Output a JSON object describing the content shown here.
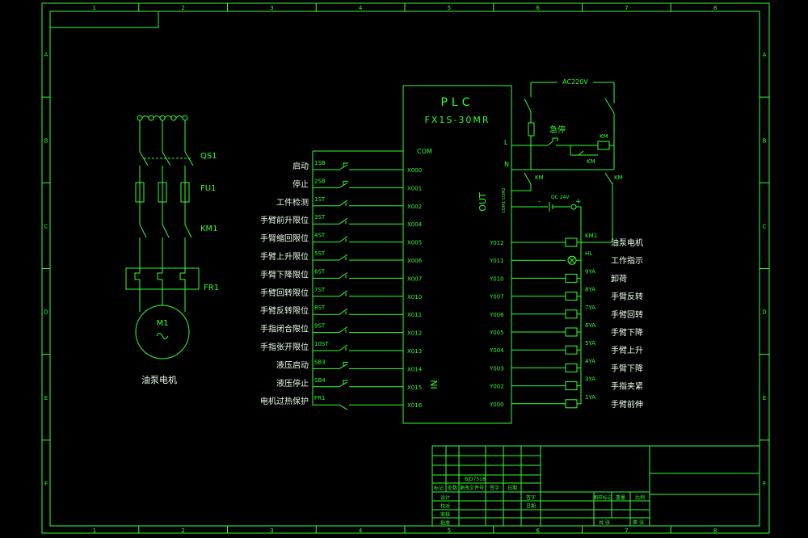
{
  "colors": {
    "background": "#000000",
    "line": "#33ff33",
    "label": "#e8ffe8"
  },
  "border": {
    "columns": [
      "1",
      "2",
      "3",
      "4",
      "5",
      "6",
      "7",
      "8"
    ],
    "rows": [
      "A",
      "B",
      "C",
      "D",
      "E",
      "F"
    ]
  },
  "plc": {
    "title": "PLC",
    "model": "FX1S-30MR",
    "com": "COM",
    "out_label": "OUT",
    "out_com": "COM1 COM2",
    "in_label": "IN"
  },
  "motor_circuit": {
    "breaker": "QS1",
    "fuse": "FU1",
    "contactor": "KM1",
    "overload": "FR1",
    "motor_name": "M1",
    "motor_type": "3~",
    "caption": "油泵电机"
  },
  "inputs": [
    {
      "device": "1SB",
      "label": "启动",
      "addr": "X000"
    },
    {
      "device": "2SB",
      "label": "停止",
      "addr": "X001"
    },
    {
      "device": "1ST",
      "label": "工件检测",
      "addr": "X002"
    },
    {
      "device": "3ST",
      "label": "手臂前升限位",
      "addr": "X004"
    },
    {
      "device": "4ST",
      "label": "手臂缩回限位",
      "addr": "X005"
    },
    {
      "device": "5ST",
      "label": "手臂上升限位",
      "addr": "X006"
    },
    {
      "device": "6ST",
      "label": "手臂下降限位",
      "addr": "X007"
    },
    {
      "device": "7ST",
      "label": "手臂回转限位",
      "addr": "X010"
    },
    {
      "device": "8ST",
      "label": "手臂反转限位",
      "addr": "X011"
    },
    {
      "device": "9ST",
      "label": "手指闭合限位",
      "addr": "X012"
    },
    {
      "device": "10ST",
      "label": "手指张开限位",
      "addr": "X013"
    },
    {
      "device": "SB3",
      "label": "液压启动",
      "addr": "X014"
    },
    {
      "device": "SB4",
      "label": "液压停止",
      "addr": "X015"
    },
    {
      "device": "FR1",
      "label": "电机过热保护",
      "addr": "X016"
    }
  ],
  "outputs": [
    {
      "addr": "Y012",
      "device": "KM1",
      "label": "油泵电机"
    },
    {
      "addr": "Y011",
      "device": "HL",
      "label": "工作指示"
    },
    {
      "addr": "Y010",
      "device": "9YA",
      "label": "卸荷"
    },
    {
      "addr": "Y007",
      "device": "8YA",
      "label": "手臂反转"
    },
    {
      "addr": "Y006",
      "device": "7YA",
      "label": "手臂回转"
    },
    {
      "addr": "Y005",
      "device": "6YA",
      "label": "手臂下降"
    },
    {
      "addr": "Y004",
      "device": "5YA",
      "label": "手臂上升"
    },
    {
      "addr": "Y003",
      "device": "4YA",
      "label": "手臂下降"
    },
    {
      "addr": "Y002",
      "device": "3YA",
      "label": "手指夹紧"
    },
    {
      "addr": "Y000",
      "device": "1YA",
      "label": "手臂前伸"
    }
  ],
  "power_circuit": {
    "supply": "AC220V",
    "estop": "急停",
    "km": "KM",
    "l": "L",
    "n": "N",
    "dc": "DC 24V",
    "minus": "-",
    "plus": "+"
  },
  "title_block": {
    "drawing_no": "BJD7518",
    "headings": [
      "标记",
      "处数",
      "更改文件号",
      "签字",
      "日期"
    ],
    "rows": [
      "设计",
      "校对",
      "审核",
      "批准"
    ],
    "mid": [
      "签字",
      "日期"
    ],
    "right": [
      "图样标记",
      "重量",
      "比例"
    ],
    "sheet": [
      "共",
      "张",
      "第",
      "张"
    ]
  }
}
